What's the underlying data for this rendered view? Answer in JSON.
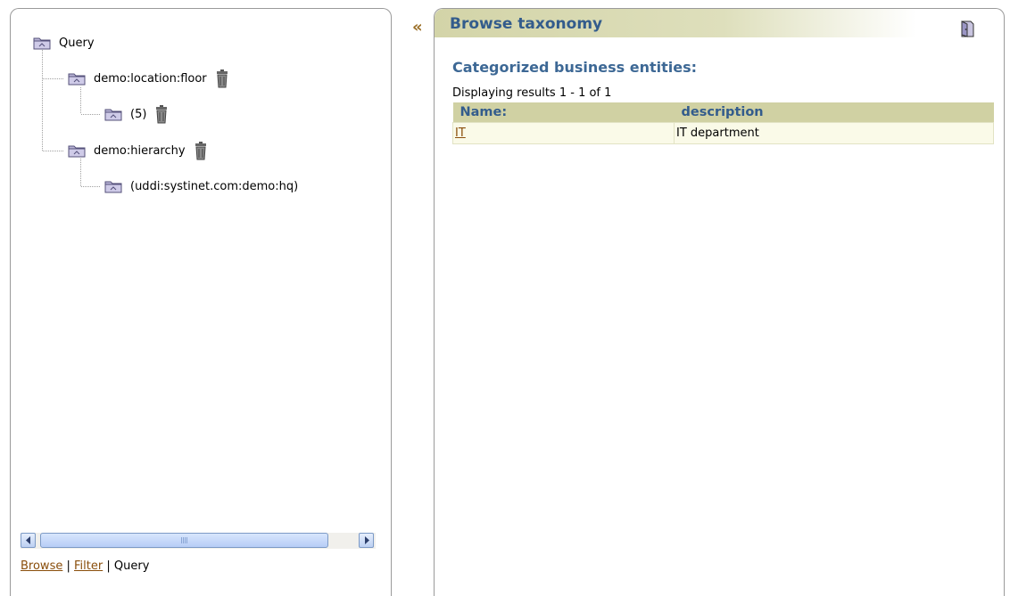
{
  "tree": {
    "root": {
      "label": "Query"
    },
    "nodes": [
      {
        "label": "demo:location:floor",
        "deletable": true
      },
      {
        "label": "(5)",
        "deletable": true
      },
      {
        "label": "demo:hierarchy",
        "deletable": true
      },
      {
        "label": "(uddi:systinet.com:demo:hq)",
        "deletable": false
      }
    ]
  },
  "left_links": {
    "browse": "Browse",
    "separator": "|",
    "filter": "Filter",
    "query": "Query"
  },
  "collapse_symbol": "«",
  "panel": {
    "title": "Browse taxonomy",
    "section_title": "Categorized business entities:",
    "results_info": "Displaying results 1 - 1 of 1",
    "table": {
      "headers": [
        "Name:",
        "description"
      ],
      "rows": [
        {
          "name": "IT",
          "description": "IT department"
        }
      ]
    }
  },
  "colors": {
    "title_blue": "#335c8c",
    "link_brown": "#8a4e0b",
    "header_olive": "#d0d1a3"
  },
  "icons": [
    "folder-icon",
    "trash-icon",
    "exit-icon",
    "scroll-left-icon",
    "scroll-right-icon"
  ]
}
